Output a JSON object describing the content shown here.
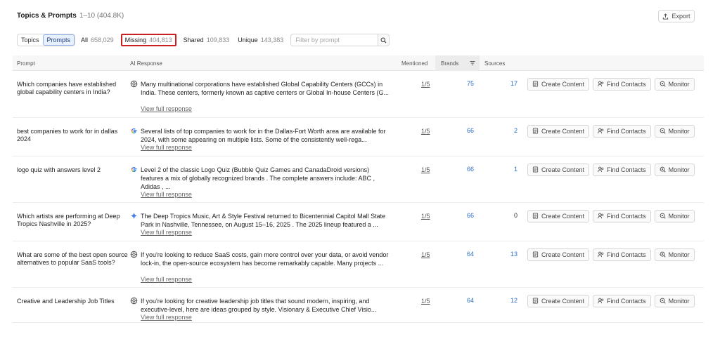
{
  "header": {
    "title": "Topics & Prompts",
    "range": "1–10 (404.8K)",
    "export_label": "Export"
  },
  "filters": {
    "toggle": [
      "Topics",
      "Prompts"
    ],
    "active_toggle": "Prompts",
    "pills": [
      {
        "label": "All",
        "count": "658,029"
      },
      {
        "label": "Missing",
        "count": "404,813",
        "highlighted": true
      },
      {
        "label": "Shared",
        "count": "109,833"
      },
      {
        "label": "Unique",
        "count": "143,383"
      }
    ],
    "search_placeholder": "Filter by prompt"
  },
  "table": {
    "headers": {
      "prompt": "Prompt",
      "ai_response": "AI Response",
      "mentioned": "Mentioned",
      "brands": "Brands",
      "sources": "Sources"
    },
    "action_labels": {
      "create": "Create Content",
      "find": "Find Contacts",
      "monitor": "Monitor"
    },
    "view_label": "View full response",
    "rows": [
      {
        "prompt": "Which companies have established global capability centers in India?",
        "engine": "openai",
        "response": "Many multinational corporations have established Global Capability Centers (GCCs) in India. These centers, formerly known as captive centers or Global In-house Centers (G...",
        "mentioned": "1/5",
        "brands": "75",
        "sources": "17"
      },
      {
        "prompt": "best companies to work for in dallas 2024",
        "engine": "google",
        "response": "Several lists of top companies to work for in the Dallas-Fort Worth area are available for 2024, with some appearing on multiple lists. Some of the consistently well-rega...",
        "mentioned": "1/5",
        "brands": "66",
        "sources": "2"
      },
      {
        "prompt": "logo quiz with answers level 2",
        "engine": "google",
        "response": "Level 2 of the classic Logo Quiz (Bubble Quiz Games and CanadaDroid versions) features a mix of globally recognized brands . The complete answers include: ABC , Adidas , ...",
        "mentioned": "1/5",
        "brands": "66",
        "sources": "1"
      },
      {
        "prompt": "Which artists are performing at Deep Tropics Nashville in 2025?",
        "engine": "gemini",
        "response": "The Deep Tropics Music, Art & Style Festival returned to Bicentennial Capitol Mall State Park in Nashville, Tennessee, on August 15–16, 2025 . The 2025 lineup featured a ...",
        "mentioned": "1/5",
        "brands": "66",
        "sources": "0"
      },
      {
        "prompt": "What are some of the best open source alternatives to popular SaaS tools?",
        "engine": "openai",
        "response": "If you're looking to reduce SaaS costs, gain more control over your data, or avoid vendor lock-in, the open-source ecosystem has become remarkably capable. Many projects ...",
        "mentioned": "1/5",
        "brands": "64",
        "sources": "13"
      },
      {
        "prompt": "Creative and Leadership Job Titles",
        "engine": "openai",
        "response": "If you're looking for creative leadership job titles that sound modern, inspiring, and executive-level, here are ideas grouped by style. Visionary & Executive Chief Visio...",
        "mentioned": "1/5",
        "brands": "64",
        "sources": "12"
      }
    ]
  }
}
